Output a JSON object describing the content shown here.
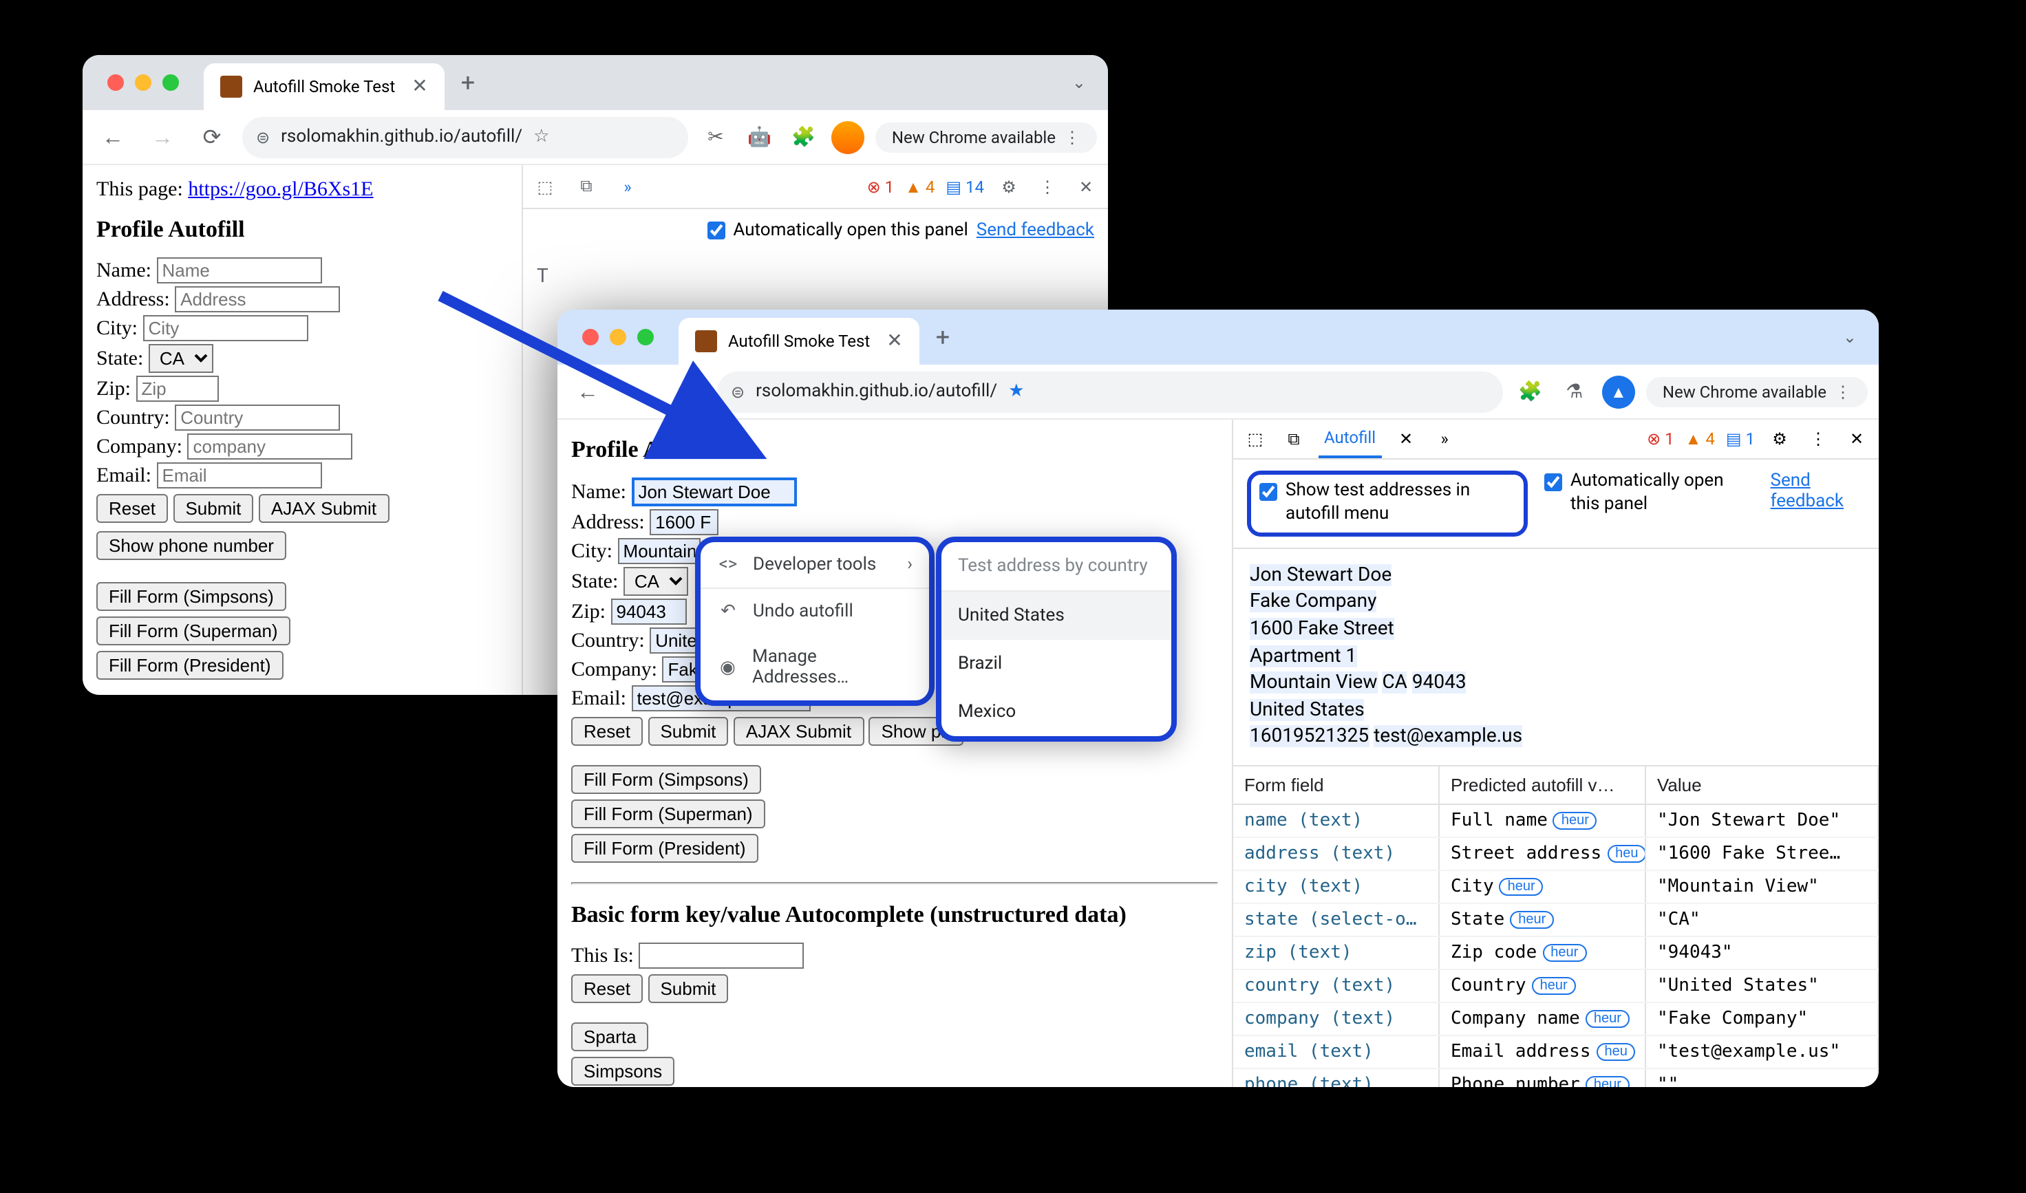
{
  "win1": {
    "tab_title": "Autofill Smoke Test",
    "url": "rsolomakhin.github.io/autofill/",
    "chip": "New Chrome available",
    "page": {
      "this_page": "This page: ",
      "link": "https://goo.gl/B6Xs1E",
      "h1": "Profile Autofill",
      "name_lbl": "Name:",
      "name_ph": "Name",
      "addr_lbl": "Address:",
      "addr_ph": "Address",
      "city_lbl": "City:",
      "city_ph": "City",
      "state_lbl": "State:",
      "state_val": "CA",
      "zip_lbl": "Zip:",
      "zip_ph": "Zip",
      "country_lbl": "Country:",
      "country_ph": "Country",
      "company_lbl": "Company:",
      "company_ph": "company",
      "email_lbl": "Email:",
      "email_ph": "Email",
      "reset": "Reset",
      "submit": "Submit",
      "ajax": "AJAX Submit",
      "show_phone": "Show phone number",
      "ff1": "Fill Form (Simpsons)",
      "ff2": "Fill Form (Superman)",
      "ff3": "Fill Form (President)",
      "tel_partial": "T"
    },
    "dt": {
      "err": "1",
      "warn": "4",
      "info": "14",
      "auto_open": "Automatically open this panel",
      "feedback": "Send feedback"
    }
  },
  "win2": {
    "tab_title": "Autofill Smoke Test",
    "url": "rsolomakhin.github.io/autofill/",
    "chip": "New Chrome available",
    "page": {
      "h1": "Profile Autofill",
      "name_lbl": "Name:",
      "name_val": "Jon Stewart Doe",
      "addr_lbl": "Address:",
      "addr_val": "1600 F",
      "city_lbl": "City:",
      "city_val": "Mountain",
      "state_lbl": "State:",
      "state_val": "CA",
      "zip_lbl": "Zip:",
      "zip_val": "94043",
      "country_lbl": "Country:",
      "country_val": "United",
      "company_lbl": "Company:",
      "company_val": "Fak",
      "email_lbl": "Email:",
      "email_val": "test@example.us",
      "reset": "Reset",
      "submit": "Submit",
      "ajax": "AJAX Submit",
      "show_phone": "Show ph",
      "ff1": "Fill Form (Simpsons)",
      "ff2": "Fill Form (Superman)",
      "ff3": "Fill Form (President)",
      "h2": "Basic form key/value Autocomplete (unstructured data)",
      "this_is": "This Is:",
      "reset2": "Reset",
      "submit2": "Submit",
      "sparta": "Sparta",
      "simpsons": "Simpsons"
    },
    "context": {
      "dev_tools": "Developer tools",
      "undo": "Undo autofill",
      "manage": "Manage Addresses…"
    },
    "submenu": {
      "head": "Test address by country",
      "us": "United States",
      "br": "Brazil",
      "mx": "Mexico"
    },
    "dt": {
      "tab": "Autofill",
      "err": "1",
      "warn": "4",
      "info": "1",
      "opt1": "Show test addresses in autofill menu",
      "opt2": "Automatically open this panel",
      "feedback": "Send feedback",
      "addr": {
        "l1": "Jon Stewart Doe",
        "l2": "Fake Company",
        "l3": "1600 Fake Street",
        "l4": "Apartment 1",
        "l5a": "Mountain View",
        "l5b": "CA",
        "l5c": "94043",
        "l6": "United States",
        "l7a": "16019521325",
        "l7b": "test@example.us"
      },
      "th1": "Form field",
      "th2": "Predicted autofill v…",
      "th3": "Value",
      "rows": [
        {
          "f": "name (text)",
          "p": "Full name",
          "pill": "heur",
          "v": "\"Jon Stewart Doe\""
        },
        {
          "f": "address (text)",
          "p": "Street address",
          "pill": "heu",
          "v": "\"1600 Fake Stree…"
        },
        {
          "f": "city (text)",
          "p": "City",
          "pill": "heur",
          "v": "\"Mountain View\""
        },
        {
          "f": "state (select-on…",
          "p": "State",
          "pill": "heur",
          "v": "\"CA\""
        },
        {
          "f": "zip (text)",
          "p": "Zip code",
          "pill": "heur",
          "v": "\"94043\""
        },
        {
          "f": "country (text)",
          "p": "Country",
          "pill": "heur",
          "v": "\"United States\""
        },
        {
          "f": "company (text)",
          "p": "Company name",
          "pill": "heur",
          "v": "\"Fake Company\""
        },
        {
          "f": "email (text)",
          "p": "Email address",
          "pill": "heu",
          "v": "\"test@example.us\""
        },
        {
          "f": "phone (text)",
          "p": "Phone number",
          "pill": "heur",
          "v": "\"\""
        }
      ]
    }
  }
}
